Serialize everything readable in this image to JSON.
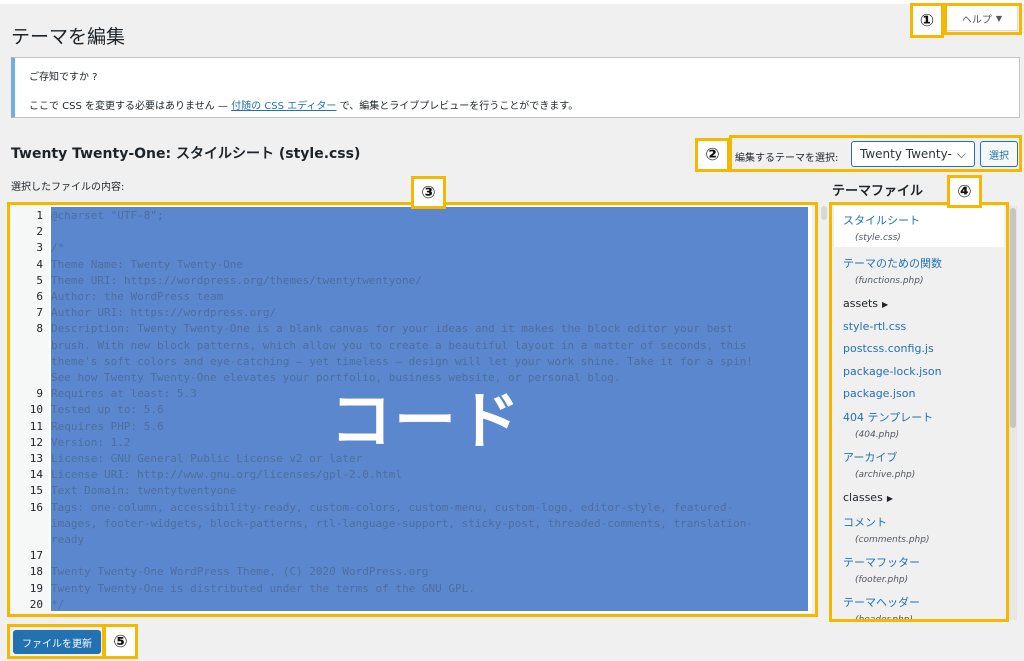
{
  "page_title": "テーマを編集",
  "help": {
    "label": "ヘルプ",
    "caret": "▼"
  },
  "notice": {
    "title": "ご存知ですか ?",
    "body_before": "ここで CSS を変更する必要はありません — ",
    "link": "付随の CSS エディター",
    "body_after": " で、編集とライブプレビューを行うことができます。"
  },
  "file_heading": "Twenty Twenty-One: スタイルシート (style.css)",
  "theme_select": {
    "label": "編集するテーマを選択:",
    "value": "Twenty Twenty-",
    "chevron": "⌵",
    "button": "選択"
  },
  "selected_file_label": "選択したファイルの内容:",
  "editor": {
    "overlay_label": "コード",
    "lines": [
      {
        "n": "1",
        "t": "@charset \"UTF-8\";"
      },
      {
        "n": "2",
        "t": ""
      },
      {
        "n": "3",
        "t": "/*"
      },
      {
        "n": "4",
        "t": "Theme Name: Twenty Twenty-One"
      },
      {
        "n": "5",
        "t": "Theme URI: https://wordpress.org/themes/twentytwentyone/"
      },
      {
        "n": "6",
        "t": "Author: the WordPress team"
      },
      {
        "n": "7",
        "t": "Author URI: https://wordpress.org/"
      },
      {
        "n": "8",
        "t": "Description: Twenty Twenty-One is a blank canvas for your ideas and it makes the block editor your best"
      },
      {
        "n": "",
        "t": "brush. With new block patterns, which allow you to create a beautiful layout in a matter of seconds, this"
      },
      {
        "n": "",
        "t": "theme's soft colors and eye-catching — yet timeless — design will let your work shine. Take it for a spin!"
      },
      {
        "n": "",
        "t": "See how Twenty Twenty-One elevates your portfolio, business website, or personal blog."
      },
      {
        "n": "9",
        "t": "Requires at least: 5.3"
      },
      {
        "n": "10",
        "t": "Tested up to: 5.6"
      },
      {
        "n": "11",
        "t": "Requires PHP: 5.6"
      },
      {
        "n": "12",
        "t": "Version: 1.2"
      },
      {
        "n": "13",
        "t": "License: GNU General Public License v2 or later"
      },
      {
        "n": "14",
        "t": "License URI: http://www.gnu.org/licenses/gpl-2.0.html"
      },
      {
        "n": "15",
        "t": "Text Domain: twentytwentyone"
      },
      {
        "n": "16",
        "t": "Tags: one-column, accessibility-ready, custom-colors, custom-menu, custom-logo, editor-style, featured-"
      },
      {
        "n": "",
        "t": "images, footer-widgets, block-patterns, rtl-language-support, sticky-post, threaded-comments, translation-"
      },
      {
        "n": "",
        "t": "ready"
      },
      {
        "n": "17",
        "t": ""
      },
      {
        "n": "18",
        "t": "Twenty Twenty-One WordPress Theme, (C) 2020 WordPress.org"
      },
      {
        "n": "19",
        "t": "Twenty Twenty-One is distributed under the terms of the GNU GPL."
      },
      {
        "n": "20",
        "t": "*/"
      }
    ]
  },
  "theme_files": {
    "heading": "テーマファイル",
    "items": [
      {
        "name": "スタイルシート",
        "sub": "(style.css)"
      },
      {
        "name": "テーマのための関数",
        "sub": "(functions.php)"
      },
      {
        "name": "assets",
        "folder_marker": "▶"
      },
      {
        "name": "style-rtl.css"
      },
      {
        "name": "postcss.config.js"
      },
      {
        "name": "package-lock.json"
      },
      {
        "name": "package.json"
      },
      {
        "name": "404 テンプレート",
        "sub": "(404.php)"
      },
      {
        "name": "アーカイブ",
        "sub": "(archive.php)"
      },
      {
        "name": "classes",
        "folder_marker": "▶"
      },
      {
        "name": "コメント",
        "sub": "(comments.php)"
      },
      {
        "name": "テーマフッター",
        "sub": "(footer.php)"
      },
      {
        "name": "テーマヘッダー",
        "sub": "(header.php)"
      }
    ]
  },
  "update_button": "ファイルを更新",
  "markers": [
    "①",
    "②",
    "③",
    "④",
    "⑤"
  ],
  "colors": {
    "highlight": "#f5b800",
    "accent": "#2271b1",
    "selection": "#5b87cf"
  }
}
